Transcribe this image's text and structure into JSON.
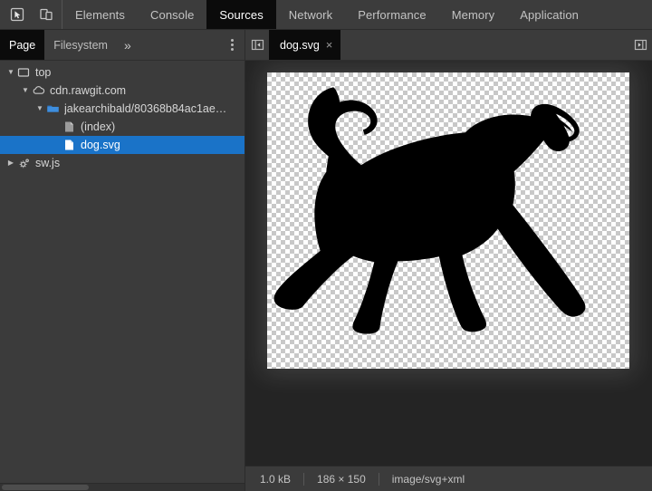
{
  "window": {
    "title": "DevTools - Sources - dog.svg"
  },
  "toolbar": {
    "inspect_icon": "inspect-element-icon",
    "device_icon": "device-toolbar-icon",
    "tabs": [
      {
        "label": "Elements",
        "selected": false
      },
      {
        "label": "Console",
        "selected": false
      },
      {
        "label": "Sources",
        "selected": true
      },
      {
        "label": "Network",
        "selected": false
      },
      {
        "label": "Performance",
        "selected": false
      },
      {
        "label": "Memory",
        "selected": false
      },
      {
        "label": "Application",
        "selected": false
      }
    ]
  },
  "navigator": {
    "tabs": [
      {
        "label": "Page",
        "selected": true
      },
      {
        "label": "Filesystem",
        "selected": false
      }
    ],
    "more_label": "»",
    "menu_icon": "more-options-icon",
    "tree": [
      {
        "label": "top",
        "icon": "frame-icon",
        "depth": 0,
        "twisty": "open",
        "selected": false
      },
      {
        "label": "cdn.rawgit.com",
        "icon": "cloud-icon",
        "depth": 1,
        "twisty": "open",
        "selected": false
      },
      {
        "label": "jakearchibald/80368b84ac1ae…",
        "icon": "folder-icon",
        "depth": 2,
        "twisty": "open",
        "selected": false
      },
      {
        "label": "(index)",
        "icon": "document-icon",
        "depth": 3,
        "twisty": "none",
        "selected": false
      },
      {
        "label": "dog.svg",
        "icon": "file-icon",
        "depth": 3,
        "twisty": "none",
        "selected": true
      },
      {
        "label": "sw.js",
        "icon": "service-worker-icon",
        "depth": 0,
        "twisty": "closed",
        "selected": false
      }
    ]
  },
  "editor": {
    "left_panel_toggle_icon": "show-navigator-icon",
    "right_panel_toggle_icon": "show-debugger-icon",
    "tabs": [
      {
        "label": "dog.svg",
        "close_label": "×",
        "selected": true
      }
    ]
  },
  "preview": {
    "alt": "black-cat-silhouette",
    "background": "transparency-checkerboard"
  },
  "status": {
    "file_size": "1.0 kB",
    "dimensions": "186 × 150",
    "mime_type": "image/svg+xml"
  },
  "colors": {
    "selection_blue": "#1a73c8",
    "tab_selected_bg": "#0b0b0b",
    "panel_bg": "#3b3b3b",
    "content_bg": "#242424"
  }
}
